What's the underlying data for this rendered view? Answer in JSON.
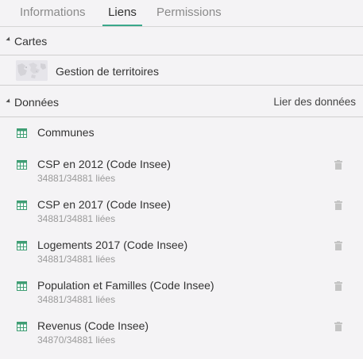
{
  "tabs": [
    "Informations",
    "Liens",
    "Permissions"
  ],
  "active_tab": "Liens",
  "cartes": {
    "title": "Cartes",
    "items": [
      {
        "label": "Gestion de territoires"
      }
    ]
  },
  "donnees": {
    "title": "Données",
    "action_label": "Lier des données",
    "items": [
      {
        "name": "Communes",
        "meta": ""
      },
      {
        "name": "CSP en 2012 (Code Insee)",
        "meta": "34881/34881 liées"
      },
      {
        "name": "CSP en 2017 (Code Insee)",
        "meta": "34881/34881 liées"
      },
      {
        "name": "Logements 2017 (Code Insee)",
        "meta": "34881/34881 liées"
      },
      {
        "name": "Population et Familles (Code Insee)",
        "meta": "34881/34881 liées"
      },
      {
        "name": "Revenus (Code Insee)",
        "meta": "34870/34881 liées"
      }
    ]
  },
  "colors": {
    "accent": "#3aa88a",
    "table_icon": "#3f9e74",
    "trash_icon": "#c4c4c4"
  },
  "icons": {
    "table": "table-icon",
    "trash": "trash-icon",
    "collapse": "caret-down-icon",
    "map": "map-thumbnail"
  }
}
